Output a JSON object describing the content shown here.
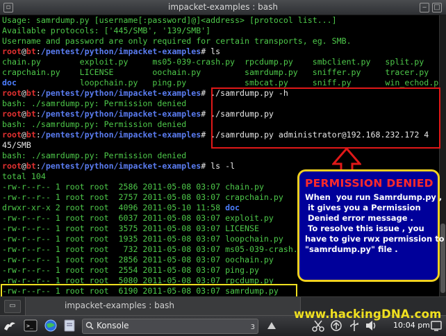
{
  "window": {
    "title": "impacket-examples : bash"
  },
  "terminal": {
    "lines": [
      {
        "parts": [
          {
            "t": "Usage: samrdump.py [username[:password]@]<address> [protocol list...]",
            "c": "g"
          }
        ]
      },
      {
        "parts": [
          {
            "t": "Available protocols: ['445/SMB', '139/SMB']",
            "c": "g"
          }
        ]
      },
      {
        "parts": [
          {
            "t": "Username and password are only required for certain transports, eg. SMB.",
            "c": "g"
          }
        ]
      },
      {
        "parts": [
          {
            "t": "root",
            "c": "r"
          },
          {
            "t": "@",
            "c": "w"
          },
          {
            "t": "bt",
            "c": "r"
          },
          {
            "t": ":",
            "c": "w"
          },
          {
            "t": "/pentest/python/impacket-examples",
            "c": "b"
          },
          {
            "t": "# ls",
            "c": "w"
          }
        ]
      },
      {
        "parts": [
          {
            "t": "chain.py        exploit.py     ms05-039-crash.py  rpcdump.py    smbclient.py   split.py",
            "c": "g"
          }
        ]
      },
      {
        "parts": [
          {
            "t": "crapchain.py    LICENSE        oochain.py         samrdump.py   sniffer.py     tracer.py",
            "c": "g"
          }
        ]
      },
      {
        "parts": [
          {
            "t": "doc",
            "c": "dir"
          },
          {
            "t": "             loopchain.py   ping.py            smbcat.py     sniff.py       win_echod.py",
            "c": "g"
          }
        ]
      },
      {
        "parts": [
          {
            "t": "root",
            "c": "r"
          },
          {
            "t": "@",
            "c": "w"
          },
          {
            "t": "bt",
            "c": "r"
          },
          {
            "t": ":",
            "c": "w"
          },
          {
            "t": "/pentest/python/impacket-examples",
            "c": "b"
          },
          {
            "t": "# ./samrdump.py -h",
            "c": "w"
          }
        ]
      },
      {
        "parts": [
          {
            "t": "bash: ./samrdump.py: Permission denied",
            "c": "g"
          }
        ]
      },
      {
        "parts": [
          {
            "t": "root",
            "c": "r"
          },
          {
            "t": "@",
            "c": "w"
          },
          {
            "t": "bt",
            "c": "r"
          },
          {
            "t": ":",
            "c": "w"
          },
          {
            "t": "/pentest/python/impacket-examples",
            "c": "b"
          },
          {
            "t": "# ./samrdump.py",
            "c": "w"
          }
        ]
      },
      {
        "parts": [
          {
            "t": "bash: ./samrdump.py: Permission denied",
            "c": "g"
          }
        ]
      },
      {
        "parts": [
          {
            "t": "root",
            "c": "r"
          },
          {
            "t": "@",
            "c": "w"
          },
          {
            "t": "bt",
            "c": "r"
          },
          {
            "t": ":",
            "c": "w"
          },
          {
            "t": "/pentest/python/impacket-examples",
            "c": "b"
          },
          {
            "t": "# ./samrdump.py administrator@192.168.232.172 4",
            "c": "w"
          }
        ]
      },
      {
        "parts": [
          {
            "t": "45/SMB",
            "c": "w"
          }
        ]
      },
      {
        "parts": [
          {
            "t": "bash: ./samrdump.py: Permission denied",
            "c": "g"
          }
        ]
      },
      {
        "parts": [
          {
            "t": "root",
            "c": "r"
          },
          {
            "t": "@",
            "c": "w"
          },
          {
            "t": "bt",
            "c": "r"
          },
          {
            "t": ":",
            "c": "w"
          },
          {
            "t": "/pentest/python/impacket-examples",
            "c": "b"
          },
          {
            "t": "# ls -l",
            "c": "w"
          }
        ]
      },
      {
        "parts": [
          {
            "t": "total 104",
            "c": "g"
          }
        ]
      },
      {
        "parts": [
          {
            "t": "-rw-r--r-- 1 root root  2586 2011-05-08 03:07 chain.py",
            "c": "g"
          }
        ]
      },
      {
        "parts": [
          {
            "t": "-rw-r--r-- 1 root root  2757 2011-05-08 03:07 crapchain.py",
            "c": "g"
          }
        ]
      },
      {
        "parts": [
          {
            "t": "drwxr-xr-x 2 root root  4096 2011-05-10 11:58 ",
            "c": "g"
          },
          {
            "t": "doc",
            "c": "dir"
          }
        ]
      },
      {
        "parts": [
          {
            "t": "-rw-r--r-- 1 root root  6037 2011-05-08 03:07 exploit.py",
            "c": "g"
          }
        ]
      },
      {
        "parts": [
          {
            "t": "-rw-r--r-- 1 root root  3575 2011-05-08 03:07 LICENSE",
            "c": "g"
          }
        ]
      },
      {
        "parts": [
          {
            "t": "-rw-r--r-- 1 root root  1935 2011-05-08 03:07 loopchain.py",
            "c": "g"
          }
        ]
      },
      {
        "parts": [
          {
            "t": "-rw-r--r-- 1 root root   732 2011-05-08 03:07 ms05-039-crash.py",
            "c": "g"
          }
        ]
      },
      {
        "parts": [
          {
            "t": "-rw-r--r-- 1 root root  2856 2011-05-08 03:07 oochain.py",
            "c": "g"
          }
        ]
      },
      {
        "parts": [
          {
            "t": "-rw-r--r-- 1 root root  2554 2011-05-08 03:07 ping.py",
            "c": "g"
          }
        ]
      },
      {
        "parts": [
          {
            "t": "-rw-r--r-- 1 root root  5080 2011-05-08 03:07 rpcdump.py",
            "c": "g"
          }
        ]
      },
      {
        "parts": [
          {
            "t": "-rw-r--r-- 1 root root  6190 2011-05-08 03:07 samrdump.py",
            "c": "g"
          }
        ]
      }
    ]
  },
  "annotation": {
    "title": "PERMISSION DENIED",
    "body": "When  you run Samrdump.py ,\n it gives you a Permission\n Denied error message .\n To resolve this issue , you\nhave to give rwx permission to\n\"samrdump.py\" file ."
  },
  "tabbar": {
    "tab_label": "impacket-examples : bash"
  },
  "taskbar": {
    "task_label": "Konsole",
    "task_count": "3",
    "clock": "10:04 pm"
  },
  "watermark": "www.hackingDNA.com",
  "colors": {
    "prompt_user": "#e03030",
    "prompt_path": "#5a7cf0",
    "output": "#4ec94a",
    "note_bg": "#00009a",
    "note_border": "#f0d020",
    "highlight_red": "#e01818"
  }
}
